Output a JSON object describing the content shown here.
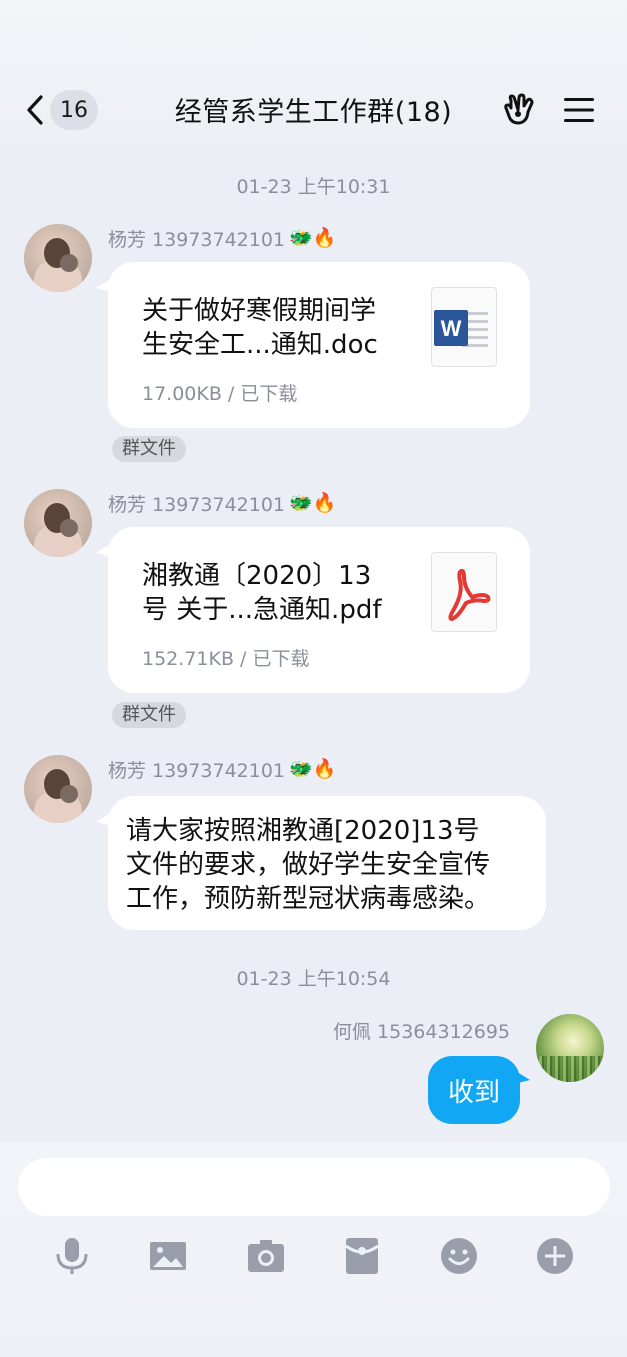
{
  "header": {
    "back_count": "16",
    "title": "经管系学生工作群(18)"
  },
  "messages": {
    "ts1": "01-23 上午10:31",
    "m1": {
      "sender": "杨芳 13973742101",
      "file_line1": "关于做好寒假期间学",
      "file_line2": "生安全工...通知.doc",
      "meta": "17.00KB / 已下载",
      "tag": "群文件"
    },
    "m2": {
      "sender": "杨芳 13973742101",
      "file_line1": "湘教通〔2020〕13",
      "file_line2": "号 关于...急通知.pdf",
      "meta": "152.71KB / 已下载",
      "tag": "群文件"
    },
    "m3": {
      "sender": "杨芳 13973742101",
      "line1": "请大家按照湘教通[2020]13号",
      "line2": "文件的要求，做好学生安全宣传",
      "line3": "工作，预防新型冠状病毒感染。"
    },
    "ts2": "01-23 上午10:54",
    "m4": {
      "sender": "何佩 15364312695",
      "text": "收到"
    },
    "badge_emojis": "🐲🔥"
  },
  "composer": {
    "input_value": ""
  },
  "colors": {
    "accent": "#11a7f5",
    "background": "#eceef6",
    "word_blue": "#2b579a",
    "pdf_red": "#e53935"
  },
  "icons": [
    "chevron-left-icon",
    "sign-language-hand-icon",
    "menu-icon",
    "word-doc-icon",
    "pdf-icon",
    "microphone-icon",
    "image-icon",
    "camera-icon",
    "red-packet-icon",
    "emoji-icon",
    "plus-icon"
  ]
}
